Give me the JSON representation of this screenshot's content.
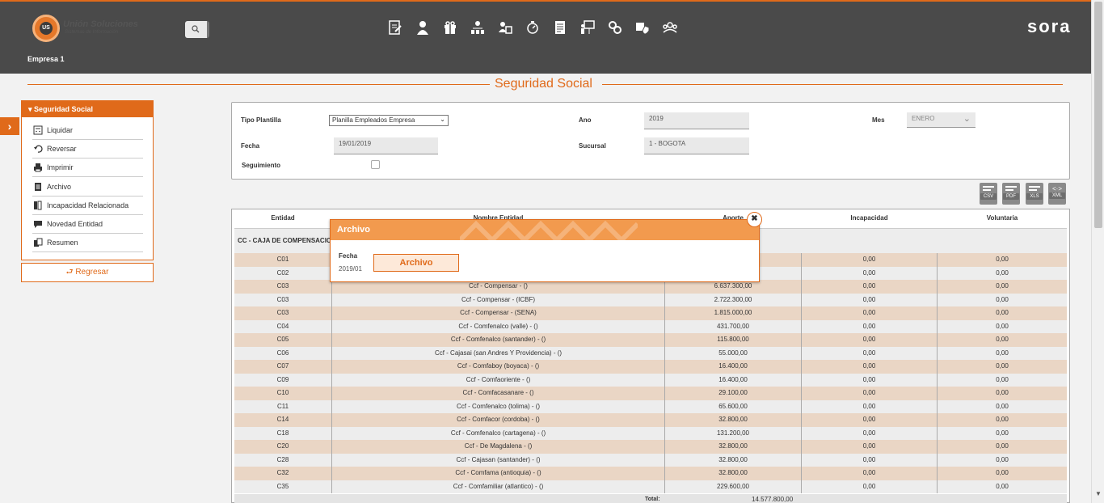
{
  "header": {
    "logo_initials": "US",
    "logo_name": "Unión Soluciones",
    "logo_sub": "Sistemas de Información",
    "brand": "sora",
    "company": "Empresa 1"
  },
  "nav_icons": [
    "document-edit-icon",
    "employee-icon",
    "gift-icon",
    "org-chart-icon",
    "users-card-icon",
    "stopwatch-icon",
    "report-icon",
    "presentation-icon",
    "gears-icon",
    "security-icon",
    "group-icon"
  ],
  "page": {
    "title": "Seguridad Social"
  },
  "sidebar": {
    "title": "Seguridad Social",
    "items": [
      {
        "label": "Liquidar",
        "icon": "calculator-icon"
      },
      {
        "label": "Reversar",
        "icon": "undo-icon"
      },
      {
        "label": "Imprimir",
        "icon": "print-icon"
      },
      {
        "label": "Archivo",
        "icon": "file-icon"
      },
      {
        "label": "Incapacidad Relacionada",
        "icon": "books-icon"
      },
      {
        "label": "Novedad Entidad",
        "icon": "comment-icon"
      },
      {
        "label": "Resumen",
        "icon": "summary-icon"
      }
    ],
    "back_label": "Regresar"
  },
  "form": {
    "tipo_plantilla_label": "Tipo Plantilla",
    "tipo_plantilla_value": "Planilla Empleados Empresa",
    "ano_label": "Ano",
    "ano_value": "2019",
    "mes_label": "Mes",
    "mes_value": "ENERO",
    "fecha_label": "Fecha",
    "fecha_value": "19/01/2019",
    "sucursal_label": "Sucursal",
    "sucursal_value": "1 - BOGOTA",
    "seguimiento_label": "Seguimiento"
  },
  "exports": [
    "CSV",
    "PDF",
    "XLS",
    "XML"
  ],
  "grid": {
    "headers": {
      "entidad": "Entidad",
      "nombre": "Nombre Entidad",
      "aporte": "Aporte",
      "incapacidad": "Incapacidad",
      "voluntaria": "Voluntaria"
    },
    "group": "CC - CAJA DE COMPENSACION",
    "rows": [
      {
        "entidad": "C01",
        "nombre": "",
        "aporte": "",
        "incapacidad": "0,00",
        "voluntaria": "0,00"
      },
      {
        "entidad": "C02",
        "nombre": "",
        "aporte": "",
        "incapacidad": "0,00",
        "voluntaria": "0,00"
      },
      {
        "entidad": "C03",
        "nombre": "Ccf - Compensar - ()",
        "aporte": "6.637.300,00",
        "incapacidad": "0,00",
        "voluntaria": "0,00"
      },
      {
        "entidad": "C03",
        "nombre": "Ccf - Compensar - (ICBF)",
        "aporte": "2.722.300,00",
        "incapacidad": "0,00",
        "voluntaria": "0,00"
      },
      {
        "entidad": "C03",
        "nombre": "Ccf - Compensar - (SENA)",
        "aporte": "1.815.000,00",
        "incapacidad": "0,00",
        "voluntaria": "0,00"
      },
      {
        "entidad": "C04",
        "nombre": "Ccf - Comfenalco (valle) - ()",
        "aporte": "431.700,00",
        "incapacidad": "0,00",
        "voluntaria": "0,00"
      },
      {
        "entidad": "C05",
        "nombre": "Ccf - Comfenalco (santander) - ()",
        "aporte": "115.800,00",
        "incapacidad": "0,00",
        "voluntaria": "0,00"
      },
      {
        "entidad": "C06",
        "nombre": "Ccf - Cajasai (san Andres Y Providencia) - ()",
        "aporte": "55.000,00",
        "incapacidad": "0,00",
        "voluntaria": "0,00"
      },
      {
        "entidad": "C07",
        "nombre": "Ccf - Comfaboy (boyaca) - ()",
        "aporte": "16.400,00",
        "incapacidad": "0,00",
        "voluntaria": "0,00"
      },
      {
        "entidad": "C09",
        "nombre": "Ccf - Comfaoriente - ()",
        "aporte": "16.400,00",
        "incapacidad": "0,00",
        "voluntaria": "0,00"
      },
      {
        "entidad": "C10",
        "nombre": "Ccf - Comfacasanare - ()",
        "aporte": "29.100,00",
        "incapacidad": "0,00",
        "voluntaria": "0,00"
      },
      {
        "entidad": "C11",
        "nombre": "Ccf - Comfenalco (tolima) - ()",
        "aporte": "65.600,00",
        "incapacidad": "0,00",
        "voluntaria": "0,00"
      },
      {
        "entidad": "C14",
        "nombre": "Ccf - Comfacor (cordoba) - ()",
        "aporte": "32.800,00",
        "incapacidad": "0,00",
        "voluntaria": "0,00"
      },
      {
        "entidad": "C18",
        "nombre": "Ccf - Comfenalco (cartagena) - ()",
        "aporte": "131.200,00",
        "incapacidad": "0,00",
        "voluntaria": "0,00"
      },
      {
        "entidad": "C20",
        "nombre": "Ccf - De Magdalena - ()",
        "aporte": "32.800,00",
        "incapacidad": "0,00",
        "voluntaria": "0,00"
      },
      {
        "entidad": "C28",
        "nombre": "Ccf - Cajasan (santander) - ()",
        "aporte": "32.800,00",
        "incapacidad": "0,00",
        "voluntaria": "0,00"
      },
      {
        "entidad": "C32",
        "nombre": "Ccf - Comfama (antioquia) - ()",
        "aporte": "32.800,00",
        "incapacidad": "0,00",
        "voluntaria": "0,00"
      },
      {
        "entidad": "C35",
        "nombre": "Ccf - Comfamiliar (atlantico) - ()",
        "aporte": "229.600,00",
        "incapacidad": "0,00",
        "voluntaria": "0,00"
      }
    ],
    "total_label": "Total:",
    "total_value": "14.577.800,00"
  },
  "modal": {
    "title": "Archivo",
    "fecha_label": "Fecha",
    "fecha_value": "2019/01",
    "button_label": "Archivo",
    "close": "✖"
  },
  "colors": {
    "accent": "#e06a1a",
    "topbar": "#4a4a4a",
    "row_alt": "#ead6c5"
  }
}
